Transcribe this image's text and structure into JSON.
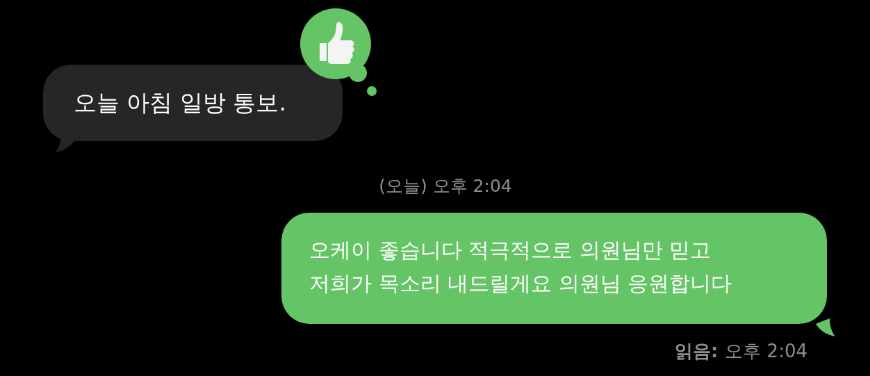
{
  "messages": [
    {
      "kind": "incoming",
      "text": "오늘 아침 일방 통보.",
      "reaction": {
        "kind": "thumbs_up"
      }
    },
    {
      "kind": "timestamp",
      "text": "(오늘) 오후 2:04"
    },
    {
      "kind": "outgoing",
      "text": "오케이 좋습니다 적극적으로 의원님만 믿고\n저희가 목소리 내드릴게요 의원님 응원합니다"
    }
  ],
  "read_receipt": {
    "label": "읽음:",
    "time": "오후 2:04"
  }
}
